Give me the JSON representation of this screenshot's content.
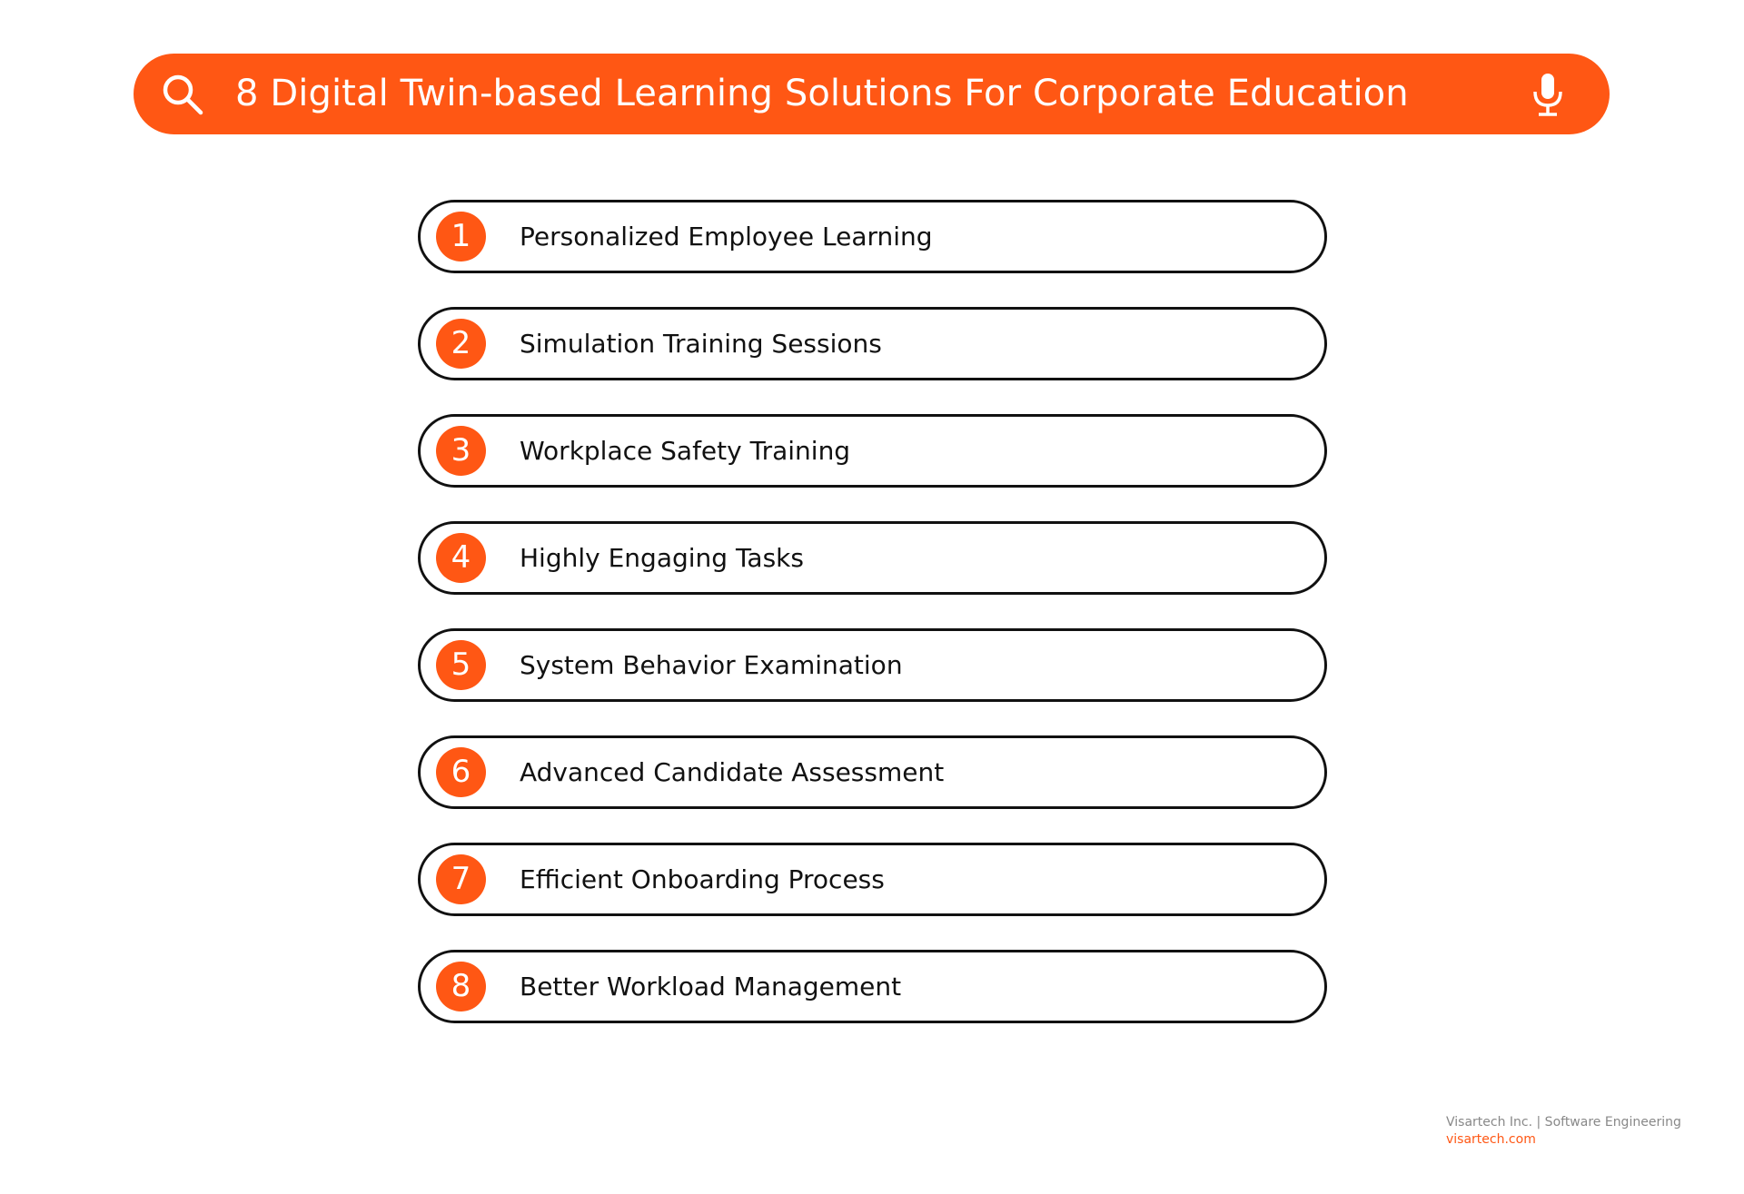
{
  "colors": {
    "accent": "#FF5714",
    "text": "#111111",
    "footer_gray": "#888888",
    "background": "#FFFFFF"
  },
  "search_bar": {
    "leading_icon": "search-icon",
    "title": "8 Digital Twin-based Learning Solutions For Corporate Education",
    "trailing_icon": "microphone-icon"
  },
  "items": [
    {
      "number": "1",
      "label": "Personalized Employee Learning"
    },
    {
      "number": "2",
      "label": "Simulation Training Sessions"
    },
    {
      "number": "3",
      "label": "Workplace Safety Training"
    },
    {
      "number": "4",
      "label": "Highly Engaging Tasks"
    },
    {
      "number": "5",
      "label": "System Behavior Examination"
    },
    {
      "number": "6",
      "label": "Advanced Candidate Assessment"
    },
    {
      "number": "7",
      "label": "Efficient Onboarding Process"
    },
    {
      "number": "8",
      "label": "Better Workload Management"
    }
  ],
  "footer": {
    "company": "Visartech Inc. | Software Engineering",
    "website": "visartech.com"
  }
}
